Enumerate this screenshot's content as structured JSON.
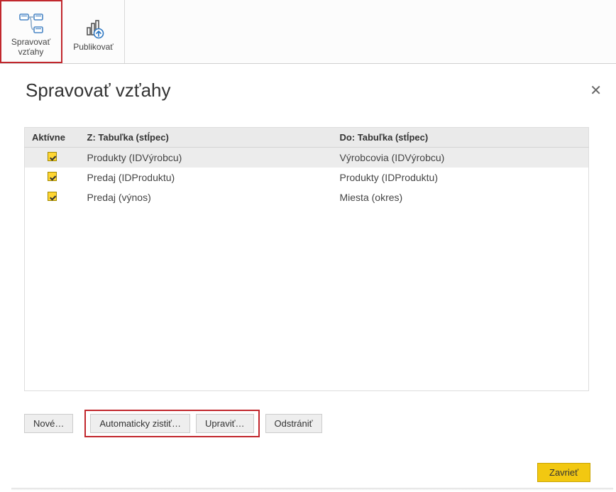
{
  "ribbon": {
    "manage_label": "Spravovať\nvzťahy",
    "publish_label": "Publikovať"
  },
  "dialog": {
    "title": "Spravovať vzťahy",
    "headers": {
      "active": "Aktívne",
      "from": "Z: Tabuľka (stĺpec)",
      "to": "Do: Tabuľka (stĺpec)"
    },
    "rows": [
      {
        "selected": true,
        "from": "Produkty (IDVýrobcu)",
        "to": "Výrobcovia (IDVýrobcu)"
      },
      {
        "selected": false,
        "from": "Predaj (IDProduktu)",
        "to": "Produkty (IDProduktu)"
      },
      {
        "selected": false,
        "from": "Predaj (výnos)",
        "to": "Miesta (okres)"
      }
    ],
    "buttons": {
      "new": "Nové…",
      "autodetect": "Automaticky zistiť…",
      "edit": "Upraviť…",
      "delete": "Odstrániť"
    },
    "close_label": "Zavrieť"
  }
}
